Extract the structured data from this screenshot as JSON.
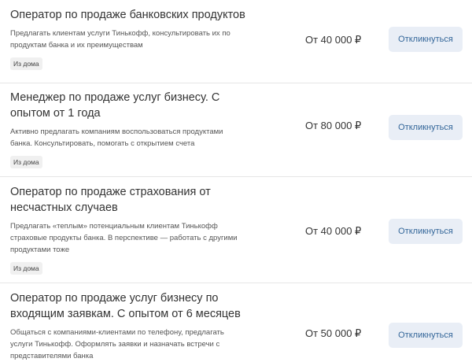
{
  "vacancies": [
    {
      "title": "Оператор по продаже банковских продуктов",
      "description": "Предлагать клиентам услуги Тинькофф, консультировать их по продуктам банка и их преимуществам",
      "badge": "Из дома",
      "salary": "От 40 000 ₽",
      "cta": "Откликнуться"
    },
    {
      "title": "Менеджер по продаже услуг бизнесу. С опытом от 1 года",
      "description": "Активно предлагать компаниям воспользоваться продуктами банка. Консультировать, помогать с открытием счета",
      "badge": "Из дома",
      "salary": "От 80 000 ₽",
      "cta": "Откликнуться"
    },
    {
      "title": "Оператор по продаже страхования от несчастных случаев",
      "description": "Предлагать «теплым» потенциальным клиентам Тинькофф страховые продукты банка. В перспективе — работать с другими продуктами тоже",
      "badge": "Из дома",
      "salary": "От 40 000 ₽",
      "cta": "Откликнуться"
    },
    {
      "title": "Оператор по продаже услуг бизнесу по входящим заявкам. С опытом от 6 месяцев",
      "description": "Общаться с компаниями-клиентами по телефону, предлагать услуги Тинькофф. Оформлять заявки и назначать встречи с представителями банка",
      "badge": "",
      "salary": "От 50 000 ₽",
      "cta": "Откликнуться"
    }
  ]
}
